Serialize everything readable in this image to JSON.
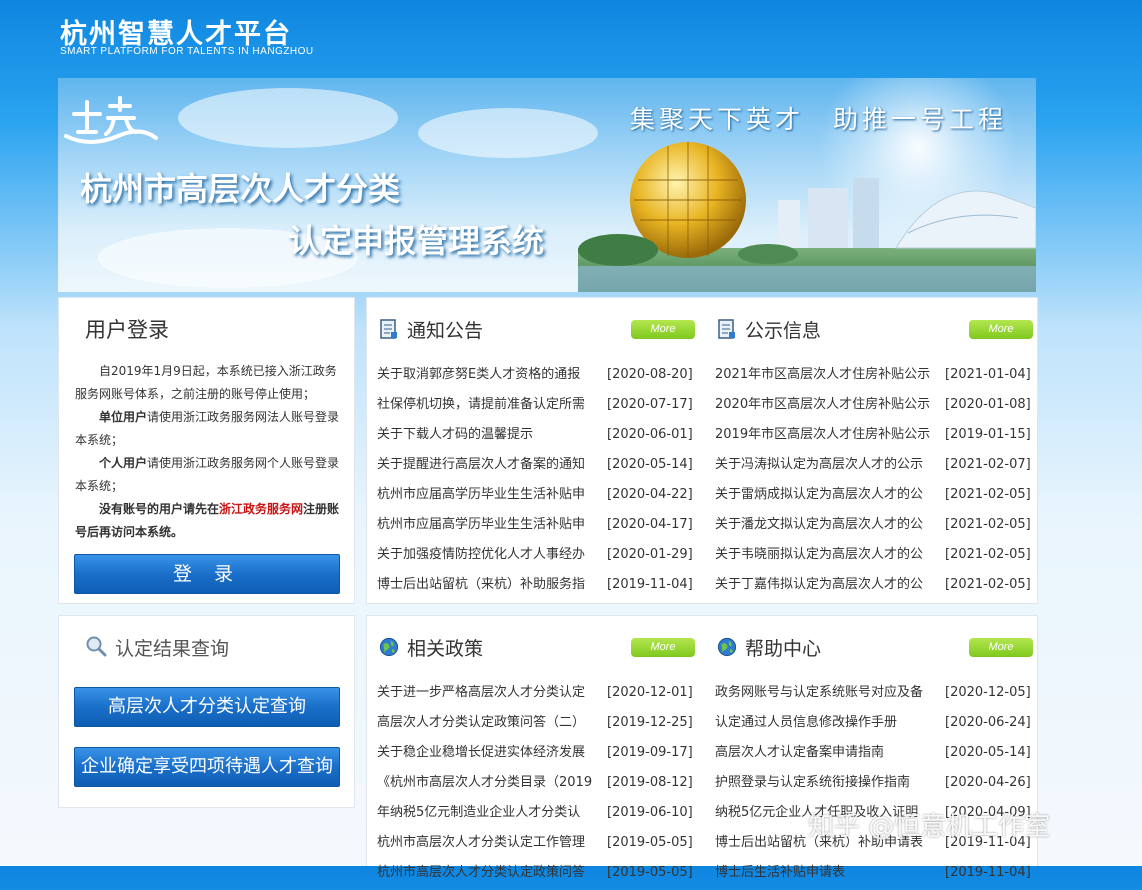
{
  "header": {
    "logo_title": "杭州智慧人才平台",
    "logo_subtitle": "SMART PLATFORM FOR TALENTS IN HANGZHOU"
  },
  "banner": {
    "slogan": "集聚天下英才　助推一号工程",
    "system_line1": "杭州市高层次人才分类",
    "system_line2": "认定申报管理系统"
  },
  "login": {
    "title": "用户登录",
    "para1": "自2019年1月9日起，本系统已接入浙江政务服务网账号体系，之前注册的账号停止使用；",
    "para2_bold": "单位用户",
    "para2_rest": "请使用浙江政务服务网法人账号登录本系统；",
    "para3_bold": "个人用户",
    "para3_rest": "请使用浙江政务服务网个人账号登录本系统；",
    "para4_a": "没有账号的用户请先在",
    "para4_link": "浙江政务服务网",
    "para4_b": "注册账号后再访问本系统。",
    "button": "登 录"
  },
  "query": {
    "title": "认定结果查询",
    "button1": "高层次人才分类认定查询",
    "button2": "企业确定享受四项待遇人才查询"
  },
  "more_label": "More",
  "notices": {
    "title": "通知公告",
    "items": [
      {
        "title": "关于取消郭彦努E类人才资格的通报",
        "date": "[2020-08-20]"
      },
      {
        "title": "社保停机切换，请提前准备认定所需",
        "date": "[2020-07-17]"
      },
      {
        "title": "关于下载人才码的温馨提示",
        "date": "[2020-06-01]"
      },
      {
        "title": "关于提醒进行高层次人才备案的通知",
        "date": "[2020-05-14]"
      },
      {
        "title": "杭州市应届高学历毕业生生活补贴申",
        "date": "[2020-04-22]"
      },
      {
        "title": "杭州市应届高学历毕业生生活补贴申",
        "date": "[2020-04-17]"
      },
      {
        "title": "关于加强疫情防控优化人才人事经办",
        "date": "[2020-01-29]"
      },
      {
        "title": "博士后出站留杭（来杭）补助服务指",
        "date": "[2019-11-04]"
      }
    ]
  },
  "publicity": {
    "title": "公示信息",
    "items": [
      {
        "title": "2021年市区高层次人才住房补贴公示",
        "date": "[2021-01-04]"
      },
      {
        "title": "2020年市区高层次人才住房补贴公示",
        "date": "[2020-01-08]"
      },
      {
        "title": "2019年市区高层次人才住房补贴公示",
        "date": "[2019-01-15]"
      },
      {
        "title": "关于冯涛拟认定为高层次人才的公示",
        "date": "[2021-02-07]"
      },
      {
        "title": "关于雷炳成拟认定为高层次人才的公",
        "date": "[2021-02-05]"
      },
      {
        "title": "关于潘龙文拟认定为高层次人才的公",
        "date": "[2021-02-05]"
      },
      {
        "title": "关于韦晓丽拟认定为高层次人才的公",
        "date": "[2021-02-05]"
      },
      {
        "title": "关于丁嘉伟拟认定为高层次人才的公",
        "date": "[2021-02-05]"
      }
    ]
  },
  "policies": {
    "title": "相关政策",
    "items": [
      {
        "title": "关于进一步严格高层次人才分类认定",
        "date": "[2020-12-01]"
      },
      {
        "title": "高层次人才分类认定政策问答（二）",
        "date": "[2019-12-25]"
      },
      {
        "title": "关于稳企业稳增长促进实体经济发展",
        "date": "[2019-09-17]"
      },
      {
        "title": "《杭州市高层次人才分类目录（2019",
        "date": "[2019-08-12]"
      },
      {
        "title": "年纳税5亿元制造业企业人才分类认",
        "date": "[2019-06-10]"
      },
      {
        "title": "杭州市高层次人才分类认定工作管理",
        "date": "[2019-05-05]"
      },
      {
        "title": "杭州市高层次人才分类认定政策问答",
        "date": "[2019-05-05]"
      }
    ]
  },
  "help": {
    "title": "帮助中心",
    "items": [
      {
        "title": "政务网账号与认定系统账号对应及备",
        "date": "[2020-12-05]"
      },
      {
        "title": "认定通过人员信息修改操作手册",
        "date": "[2020-06-24]"
      },
      {
        "title": "高层次人才认定备案申请指南",
        "date": "[2020-05-14]"
      },
      {
        "title": "护照登录与认定系统衔接操作指南",
        "date": "[2020-04-26]"
      },
      {
        "title": "纳税5亿元企业人才任职及收入证明",
        "date": "[2020-04-09]"
      },
      {
        "title": "博士后出站留杭（来杭）补助申请表",
        "date": "[2019-11-04]"
      },
      {
        "title": "博士后生活补贴申请表",
        "date": "[2019-11-04]"
      }
    ]
  },
  "watermark": "知乎 @恒意机工作室"
}
